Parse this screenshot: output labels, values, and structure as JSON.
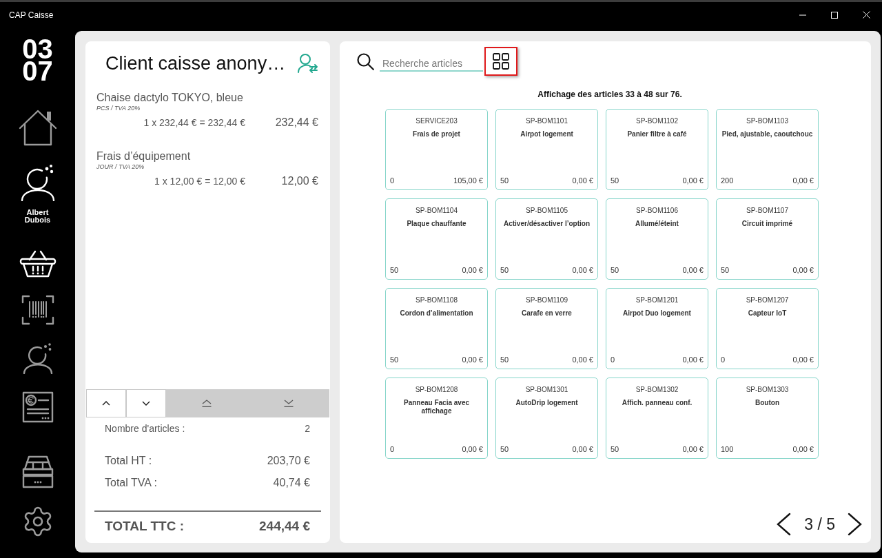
{
  "window": {
    "title": "CAP Caisse"
  },
  "sidebar": {
    "clock": [
      "03",
      "07"
    ],
    "items": [
      {
        "kind": "home",
        "selected": false
      },
      {
        "kind": "user",
        "selected": true,
        "label": "Albert Dubois"
      },
      {
        "kind": "basket",
        "selected": true
      },
      {
        "kind": "barcode",
        "selected": false
      },
      {
        "kind": "customer",
        "selected": false
      },
      {
        "kind": "invoice",
        "selected": false
      }
    ],
    "bottom_items": [
      {
        "kind": "register",
        "selected": false
      },
      {
        "kind": "settings",
        "selected": false
      }
    ]
  },
  "cart": {
    "customer_name": "Client caisse anony…",
    "lines": [
      {
        "name": "Chaise dactylo TOKYO, bleue",
        "unit_info": "PCS / TVA 20%",
        "calculation": "1 x 232,44 € = 232,44 €",
        "amount": "232,44 €"
      },
      {
        "name": "Frais d’équipement",
        "unit_info": "JOUR / TVA 20%",
        "calculation": "1 x 12,00 € = 12,00 €",
        "amount": "12,00 €"
      }
    ],
    "scroll_buttons": [
      {
        "kind": "line_up"
      },
      {
        "kind": "line_down"
      },
      {
        "kind": "page_up"
      },
      {
        "kind": "page_down"
      }
    ],
    "item_count": {
      "label": "Nombre d'articles :",
      "value": "2"
    },
    "totals": [
      {
        "label": "Total HT :",
        "value": "203,70 €"
      },
      {
        "label": "Total TVA :",
        "value": "40,74 €"
      }
    ],
    "grand_total": {
      "label": "TOTAL TTC :",
      "value": "244,44 €"
    }
  },
  "catalog": {
    "search": {
      "placeholder": "Recherche articles"
    },
    "view_toggle": {
      "focused": true
    },
    "range_text": "Affichage des articles 33 à 48 sur 76.",
    "articles": [
      {
        "code": "SERVICE203",
        "name": "Frais de projet",
        "quantity": "0",
        "price": "105,00 €"
      },
      {
        "code": "SP-BOM1101",
        "name": "Airpot logement",
        "quantity": "50",
        "price": "0,00 €"
      },
      {
        "code": "SP-BOM1102",
        "name": "Panier filtre à café",
        "quantity": "50",
        "price": "0,00 €"
      },
      {
        "code": "SP-BOM1103",
        "name": "Pied, ajustable, caoutchouc",
        "quantity": "200",
        "price": "0,00 €"
      },
      {
        "code": "SP-BOM1104",
        "name": "Plaque chauffante",
        "quantity": "50",
        "price": "0,00 €"
      },
      {
        "code": "SP-BOM1105",
        "name": "Activer/désactiver l’option",
        "quantity": "50",
        "price": "0,00 €"
      },
      {
        "code": "SP-BOM1106",
        "name": "Allumé/éteint",
        "quantity": "50",
        "price": "0,00 €"
      },
      {
        "code": "SP-BOM1107",
        "name": "Circuit imprimé",
        "quantity": "50",
        "price": "0,00 €"
      },
      {
        "code": "SP-BOM1108",
        "name": "Cordon d’alimentation",
        "quantity": "50",
        "price": "0,00 €"
      },
      {
        "code": "SP-BOM1109",
        "name": "Carafe en verre",
        "quantity": "50",
        "price": "0,00 €"
      },
      {
        "code": "SP-BOM1201",
        "name": "Airpot Duo logement",
        "quantity": "0",
        "price": "0,00 €"
      },
      {
        "code": "SP-BOM1207",
        "name": "Capteur IoT",
        "quantity": "0",
        "price": "0,00 €"
      },
      {
        "code": "SP-BOM1208",
        "name": "Panneau Facia avec affichage",
        "quantity": "0",
        "price": "0,00 €"
      },
      {
        "code": "SP-BOM1301",
        "name": "AutoDrip logement",
        "quantity": "50",
        "price": "0,00 €"
      },
      {
        "code": "SP-BOM1302",
        "name": "Affich. panneau conf.",
        "quantity": "50",
        "price": "0,00 €"
      },
      {
        "code": "SP-BOM1303",
        "name": "Bouton",
        "quantity": "100",
        "price": "0,00 €"
      }
    ],
    "pagination": {
      "page": "3 / 5"
    }
  }
}
